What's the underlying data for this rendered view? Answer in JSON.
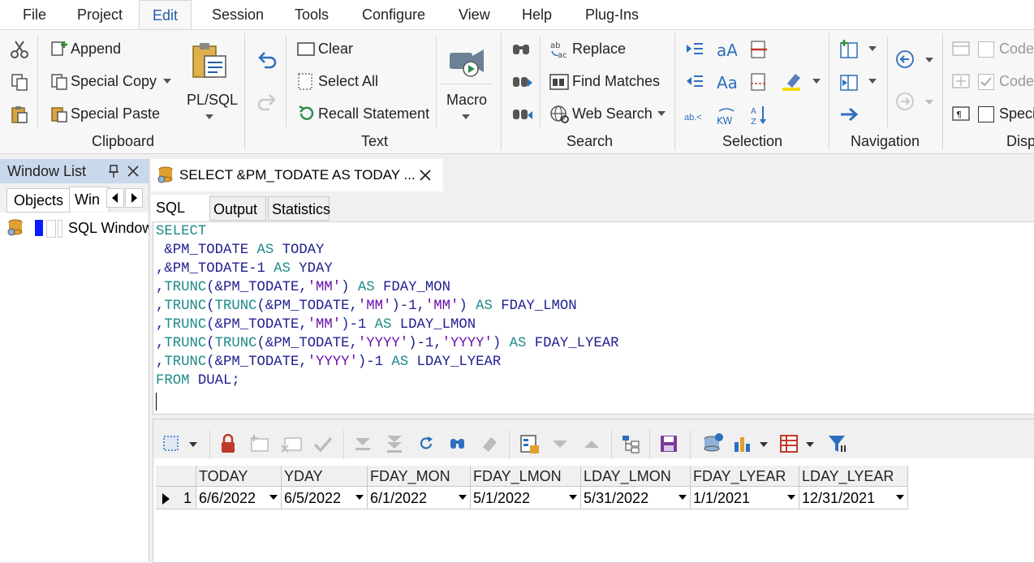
{
  "menu": [
    "File",
    "Project",
    "Edit",
    "Session",
    "Tools",
    "Configure",
    "View",
    "Help",
    "Plug-Ins"
  ],
  "ribbon": {
    "clipboard": {
      "append": "Append",
      "special_copy": "Special Copy",
      "special_paste": "Special Paste",
      "plsql": "PL/SQL",
      "group": "Clipboard"
    },
    "text": {
      "clear": "Clear",
      "select_all": "Select All",
      "recall": "Recall Statement",
      "macro": "Macro",
      "group": "Text"
    },
    "search": {
      "replace": "Replace",
      "find_matches": "Find Matches",
      "web_search": "Web Search",
      "group": "Search"
    },
    "selection": {
      "group": "Selection",
      "abc": "ab.<",
      "kw": "KW"
    },
    "navigation": {
      "group": "Navigation"
    },
    "display": {
      "code1": "Code",
      "code2": "Code",
      "special": "Speci",
      "group": "Disp"
    }
  },
  "window_list": {
    "title": "Window List",
    "tab_objects": "Objects",
    "tab_windows": "Win",
    "item": "SQL Window"
  },
  "document": {
    "tab_title": "SELECT &PM_TODATE AS TODAY ...",
    "tabs": [
      "SQL",
      "Output",
      "Statistics"
    ]
  },
  "sql_lines": [
    [
      {
        "t": "SELECT",
        "c": "kw"
      }
    ],
    [
      {
        "t": " &PM_TODATE ",
        "c": "id"
      },
      {
        "t": "AS",
        "c": "kw"
      },
      {
        "t": " TODAY",
        "c": "id"
      }
    ],
    [
      {
        "t": ",&PM_TODATE-1 ",
        "c": "id"
      },
      {
        "t": "AS",
        "c": "kw"
      },
      {
        "t": " YDAY",
        "c": "id"
      }
    ],
    [
      {
        "t": ",",
        "c": "id"
      },
      {
        "t": "TRUNC",
        "c": "kw"
      },
      {
        "t": "(&PM_TODATE,",
        "c": "id"
      },
      {
        "t": "'MM'",
        "c": "str"
      },
      {
        "t": ") ",
        "c": "id"
      },
      {
        "t": "AS",
        "c": "kw"
      },
      {
        "t": " FDAY_MON",
        "c": "id"
      }
    ],
    [
      {
        "t": ",",
        "c": "id"
      },
      {
        "t": "TRUNC",
        "c": "kw"
      },
      {
        "t": "(",
        "c": "id"
      },
      {
        "t": "TRUNC",
        "c": "kw"
      },
      {
        "t": "(&PM_TODATE,",
        "c": "id"
      },
      {
        "t": "'MM'",
        "c": "str"
      },
      {
        "t": ")-1,",
        "c": "id"
      },
      {
        "t": "'MM'",
        "c": "str"
      },
      {
        "t": ") ",
        "c": "id"
      },
      {
        "t": "AS",
        "c": "kw"
      },
      {
        "t": " FDAY_LMON",
        "c": "id"
      }
    ],
    [
      {
        "t": ",",
        "c": "id"
      },
      {
        "t": "TRUNC",
        "c": "kw"
      },
      {
        "t": "(&PM_TODATE,",
        "c": "id"
      },
      {
        "t": "'MM'",
        "c": "str"
      },
      {
        "t": ")-1 ",
        "c": "id"
      },
      {
        "t": "AS",
        "c": "kw"
      },
      {
        "t": " LDAY_LMON",
        "c": "id"
      }
    ],
    [
      {
        "t": ",",
        "c": "id"
      },
      {
        "t": "TRUNC",
        "c": "kw"
      },
      {
        "t": "(",
        "c": "id"
      },
      {
        "t": "TRUNC",
        "c": "kw"
      },
      {
        "t": "(&PM_TODATE,",
        "c": "id"
      },
      {
        "t": "'YYYY'",
        "c": "str"
      },
      {
        "t": ")-1,",
        "c": "id"
      },
      {
        "t": "'YYYY'",
        "c": "str"
      },
      {
        "t": ") ",
        "c": "id"
      },
      {
        "t": "AS",
        "c": "kw"
      },
      {
        "t": " FDAY_LYEAR",
        "c": "id"
      }
    ],
    [
      {
        "t": ",",
        "c": "id"
      },
      {
        "t": "TRUNC",
        "c": "kw"
      },
      {
        "t": "(&PM_TODATE,",
        "c": "id"
      },
      {
        "t": "'YYYY'",
        "c": "str"
      },
      {
        "t": ")-1 ",
        "c": "id"
      },
      {
        "t": "AS",
        "c": "kw"
      },
      {
        "t": " LDAY_LYEAR",
        "c": "id"
      }
    ],
    [
      {
        "t": "FROM",
        "c": "kw"
      },
      {
        "t": " DUAL;",
        "c": "id"
      }
    ]
  ],
  "grid": {
    "columns": [
      "TODAY",
      "YDAY",
      "FDAY_MON",
      "FDAY_LMON",
      "LDAY_LMON",
      "FDAY_LYEAR",
      "LDAY_LYEAR"
    ],
    "row_number": "1",
    "row": [
      "6/6/2022",
      "6/5/2022",
      "6/1/2022",
      "5/1/2022",
      "5/31/2022",
      "1/1/2021",
      "12/31/2021"
    ]
  },
  "colors": {
    "keyword": "#1e8a8a",
    "identifier": "#1f1f8f",
    "string": "#6a0dad",
    "accent": "#1f5da8"
  }
}
